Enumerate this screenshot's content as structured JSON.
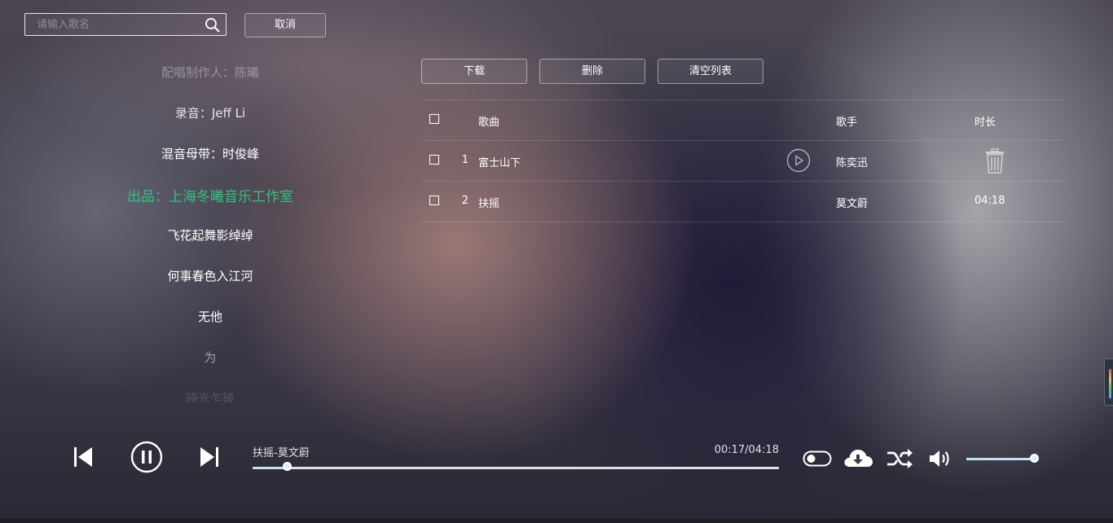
{
  "search": {
    "placeholder": "请输入歌名",
    "cancel_label": "取消"
  },
  "toolbar": {
    "download_label": "下载",
    "delete_label": "删除",
    "clear_label": "清空列表"
  },
  "lyrics": {
    "lines": [
      "配唱制作人：陈曦",
      "录音：Jeff Li",
      "混音母带：时俊峰",
      "出品：上海冬曦音乐工作室",
      "飞花起舞影绰绰",
      "何事春色入江河",
      "无他",
      "为",
      "晓光乍破"
    ],
    "active_index": 3,
    "active_color": "#31c27c"
  },
  "table": {
    "headers": {
      "song": "歌曲",
      "artist": "歌手",
      "duration": "时长"
    },
    "rows": [
      {
        "index": "1",
        "song": "富士山下",
        "artist": "陈奕迅",
        "duration": ""
      },
      {
        "index": "2",
        "song": "扶摇",
        "artist": "莫文蔚",
        "duration": "04:18"
      }
    ]
  },
  "player": {
    "now_playing": "扶摇-莫文蔚",
    "time": "00:17/04:18",
    "progress_fraction": 0.066,
    "volume_fraction": 1.0,
    "accent": "#bfe3f5"
  },
  "icons": {
    "search": "search-icon",
    "play": "play-circle-icon",
    "trash": "trash-icon",
    "prev": "skip-previous-icon",
    "pause": "pause-circle-icon",
    "next": "skip-next-icon",
    "toggle": "toggle-switch-icon",
    "download": "cloud-download-icon",
    "shuffle": "shuffle-icon",
    "volume": "volume-icon"
  }
}
